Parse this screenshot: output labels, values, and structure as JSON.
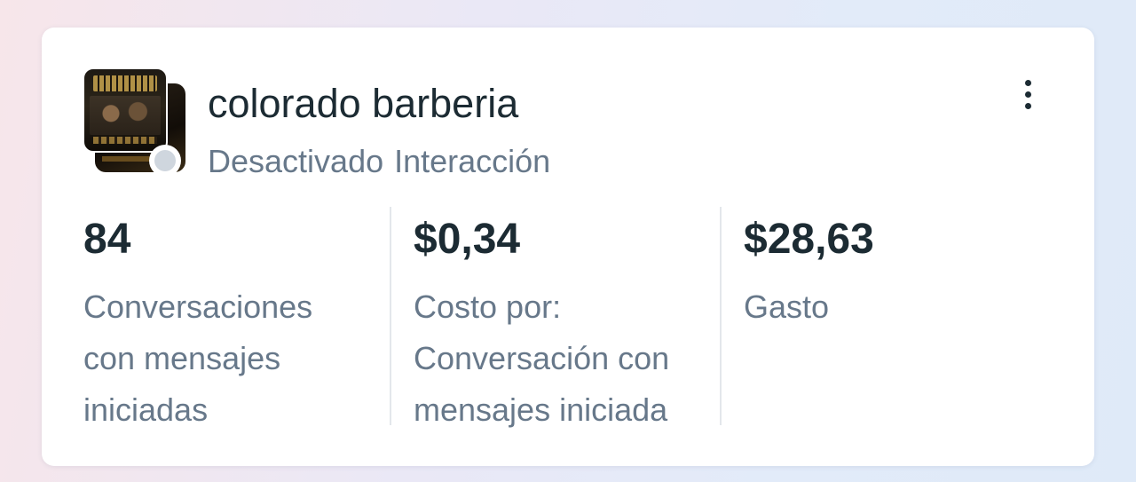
{
  "campaign": {
    "name": "colorado barberia",
    "status": "Desactivado",
    "objective": "Interacción",
    "thumbnail_icon": "ad-creative-thumbnail",
    "status_color": "#cfd6de"
  },
  "menu": {
    "icon": "more-vertical-icon"
  },
  "metrics": [
    {
      "value": "84",
      "label_lines": [
        "Conversaciones",
        "con mensajes",
        "iniciadas"
      ]
    },
    {
      "value": "$0,34",
      "label_lines": [
        "Costo por:",
        "Conversación con",
        "mensajes iniciada"
      ]
    },
    {
      "value": "$28,63",
      "label_lines": [
        "Gasto"
      ]
    }
  ],
  "colors": {
    "text_primary": "#1c2b33",
    "text_secondary": "#67788a",
    "divider": "#e3e7eb"
  }
}
